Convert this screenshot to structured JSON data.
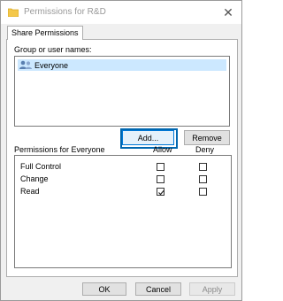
{
  "window": {
    "title": "Permissions for R&D",
    "close_glyph": "✕"
  },
  "tabs": [
    {
      "label": "Share Permissions"
    }
  ],
  "group_section": {
    "label": "Group or user names:",
    "items": [
      {
        "name": "Everyone",
        "icon": "users-icon"
      }
    ]
  },
  "buttons": {
    "add": "Add...",
    "remove": "Remove",
    "ok": "OK",
    "cancel": "Cancel",
    "apply": "Apply"
  },
  "permissions": {
    "title": "Permissions for Everyone",
    "allow_header": "Allow",
    "deny_header": "Deny",
    "rows": [
      {
        "name": "Full Control",
        "allow": false,
        "deny": false
      },
      {
        "name": "Change",
        "allow": false,
        "deny": false
      },
      {
        "name": "Read",
        "allow": true,
        "deny": false
      }
    ]
  },
  "colors": {
    "accent": "#0078d7",
    "selection": "#cce8ff",
    "disabled_text": "#8a8a8a"
  }
}
